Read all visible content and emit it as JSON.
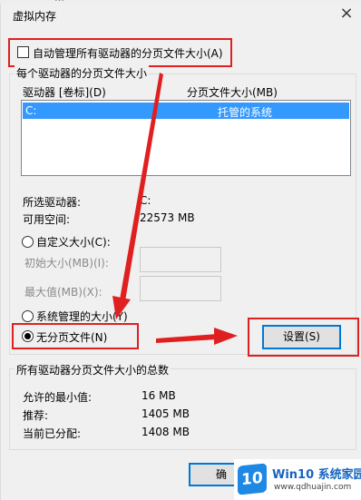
{
  "window": {
    "title": "虚拟内存",
    "close_glyph": "×",
    "obscured_top_text": "…"
  },
  "auto_manage": {
    "label": "自动管理所有驱动器的分页文件大小(A)",
    "checked": false
  },
  "drives_group": {
    "title": "每个驱动器的分页文件大小",
    "col_drive": "驱动器 [卷标](D)",
    "col_paging": "分页文件大小(MB)",
    "rows": [
      {
        "drive": "C:",
        "paging": "托管的系统",
        "selected": true
      }
    ],
    "selected_drive_label": "所选驱动器:",
    "selected_drive_value": "C:",
    "free_space_label": "可用空间:",
    "free_space_value": "22573 MB",
    "custom_size": {
      "label": "自定义大小(C):",
      "selected": false
    },
    "initial_size_label": "初始大小(MB)(I):",
    "max_size_label": "最大值(MB)(X):",
    "system_managed": {
      "label": "系统管理的大小(Y)",
      "selected": false
    },
    "no_paging": {
      "label": "无分页文件(N)",
      "selected": true
    },
    "set_button": "设置(S)"
  },
  "totals_group": {
    "title": "所有驱动器分页文件大小的总数",
    "min_label": "允许的最小值:",
    "min_value": "16 MB",
    "recommended_label": "推荐:",
    "recommended_value": "1405 MB",
    "allocated_label": "当前已分配:",
    "allocated_value": "1408 MB"
  },
  "ok_button": "确",
  "watermark": {
    "logo_text": "10",
    "brand": "Win10 系统家园",
    "url": "www.qdhuajin.com"
  },
  "colors": {
    "selection": "#3399ff",
    "annotation_red": "#e02020",
    "focus_blue": "#0078d7"
  }
}
